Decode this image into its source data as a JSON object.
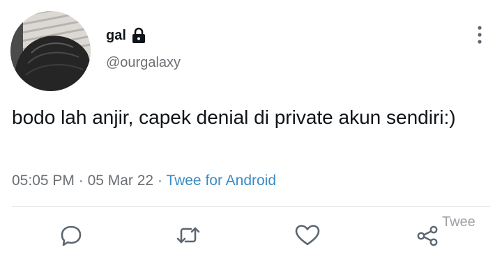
{
  "tweet": {
    "display_name": "gal",
    "handle": "@ourgalaxy",
    "text": "bodo lah anjir, capek denial di private akun sendiri:)",
    "time": "05:05 PM",
    "separator": "·",
    "date": "05 Mar 22",
    "source": "Twee for Android"
  },
  "watermark": "Twee",
  "icons": {
    "lock": "lock-icon",
    "more": "more-vertical-icon",
    "reply": "reply-icon",
    "retweet": "retweet-icon",
    "like": "heart-icon",
    "share": "share-icon"
  },
  "colors": {
    "text": "#0f1419",
    "secondary": "#6b6f74",
    "link": "#3b8bc4",
    "icon": "#5b6670",
    "divider": "#e3e6e8"
  }
}
